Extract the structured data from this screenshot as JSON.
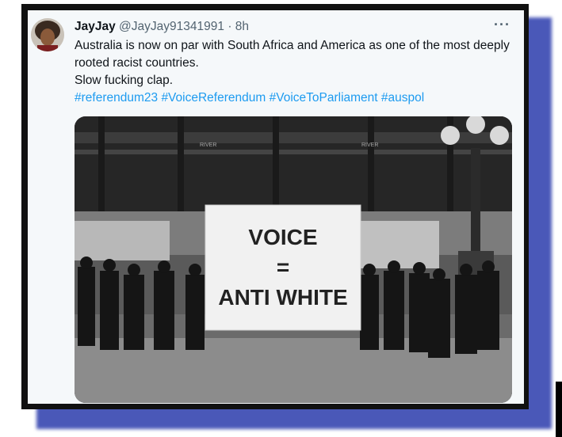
{
  "tweet": {
    "display_name": "JayJay",
    "handle": "@JayJay91341991",
    "separator": "·",
    "time": "8h",
    "more_label": "···",
    "text_line1": "Australia is now on par with South Africa and America as one of the most deeply rooted racist countries.",
    "text_line2": "Slow fucking clap.",
    "hashtags": [
      "#referendum23",
      "#VoiceReferendum",
      "#VoiceToParliament",
      "#auspol"
    ]
  },
  "media": {
    "banner_line1": "VOICE",
    "banner_line2": "=",
    "banner_line3": "ANTI WHITE",
    "station_sign_left": "RIVER",
    "station_sign_right": "RIVER"
  },
  "colors": {
    "hashtag": "#1d9bf0",
    "text": "#0f1419",
    "muted": "#536471",
    "shadow": "#4a58b8"
  }
}
